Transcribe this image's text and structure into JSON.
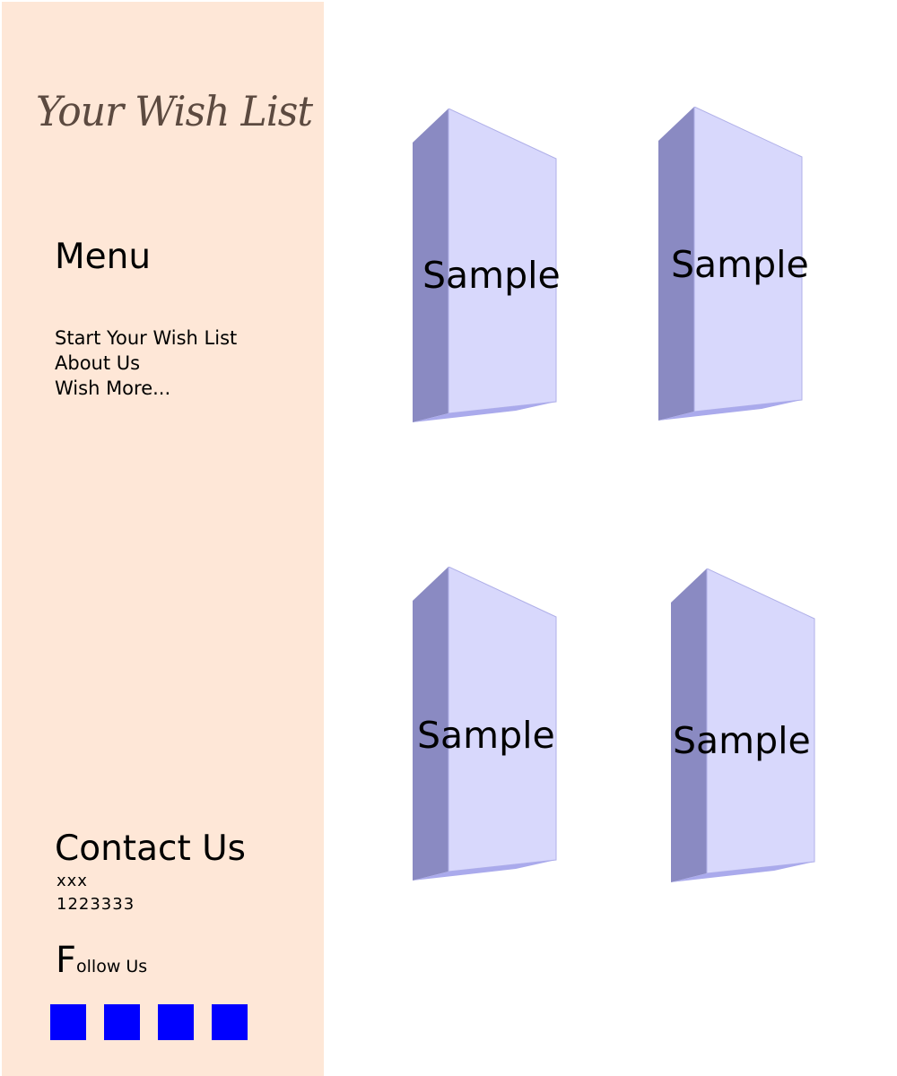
{
  "brand": {
    "title": "Your Wish List"
  },
  "menu": {
    "heading": "Menu",
    "items": [
      {
        "label": "Start Your Wish List"
      },
      {
        "label": "About Us"
      },
      {
        "label": "Wish More..."
      }
    ]
  },
  "contact": {
    "heading": "Contact Us",
    "name": "xxx",
    "phone": "1223333"
  },
  "follow": {
    "initial": "F",
    "rest": "ollow Us",
    "icons": [
      "social-icon",
      "social-icon",
      "social-icon",
      "social-icon"
    ]
  },
  "cards": [
    {
      "label": "Sample"
    },
    {
      "label": "Sample"
    },
    {
      "label": "Sample"
    },
    {
      "label": "Sample"
    }
  ],
  "colors": {
    "sidebar_bg": "#fee7d7",
    "brand_text": "#5c4a40",
    "social_icon": "#0000ff",
    "card_front": "#d8d8fc",
    "card_side": "#8a8ac2",
    "card_bottom": "#aaaaec"
  }
}
